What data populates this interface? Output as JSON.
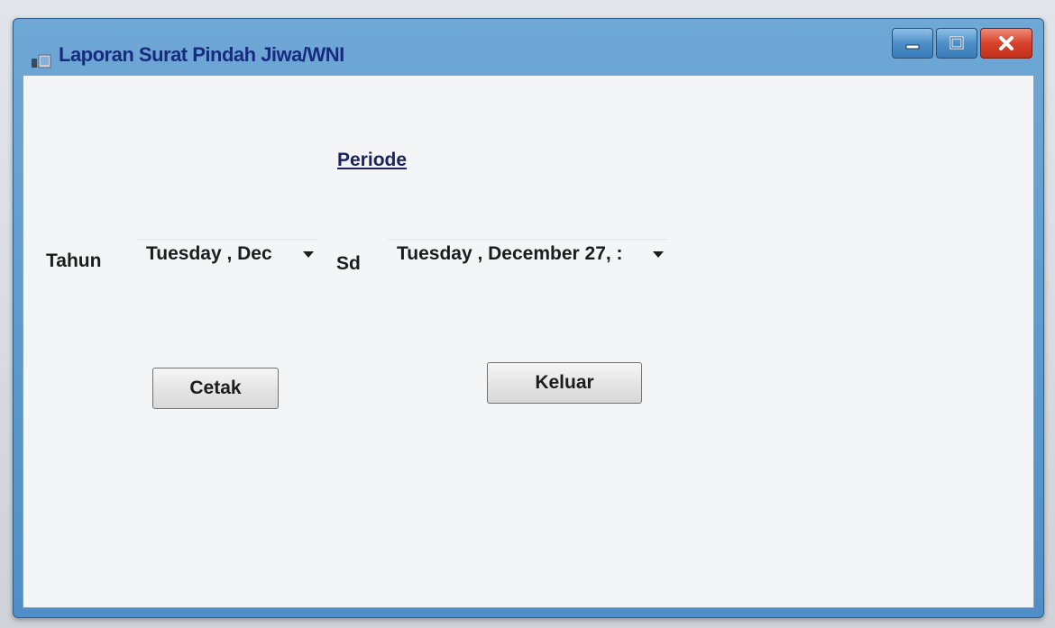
{
  "window": {
    "title": "Laporan Surat Pindah Jiwa/WNI",
    "controls": {
      "minimize_icon": "minimize-icon",
      "maximize_icon": "maximize-icon",
      "close_icon": "close-icon"
    }
  },
  "form": {
    "periode_label": "Periode",
    "tahun_label": "Tahun",
    "sd_label": "Sd",
    "date_from": "Tuesday  , Dec",
    "date_to": "Tuesday  , December 27, :"
  },
  "buttons": {
    "cetak": "Cetak",
    "keluar": "Keluar"
  },
  "colors": {
    "title_text": "#1a2a80",
    "titlebar": "#4f8ec8",
    "close_button": "#d8432b"
  }
}
